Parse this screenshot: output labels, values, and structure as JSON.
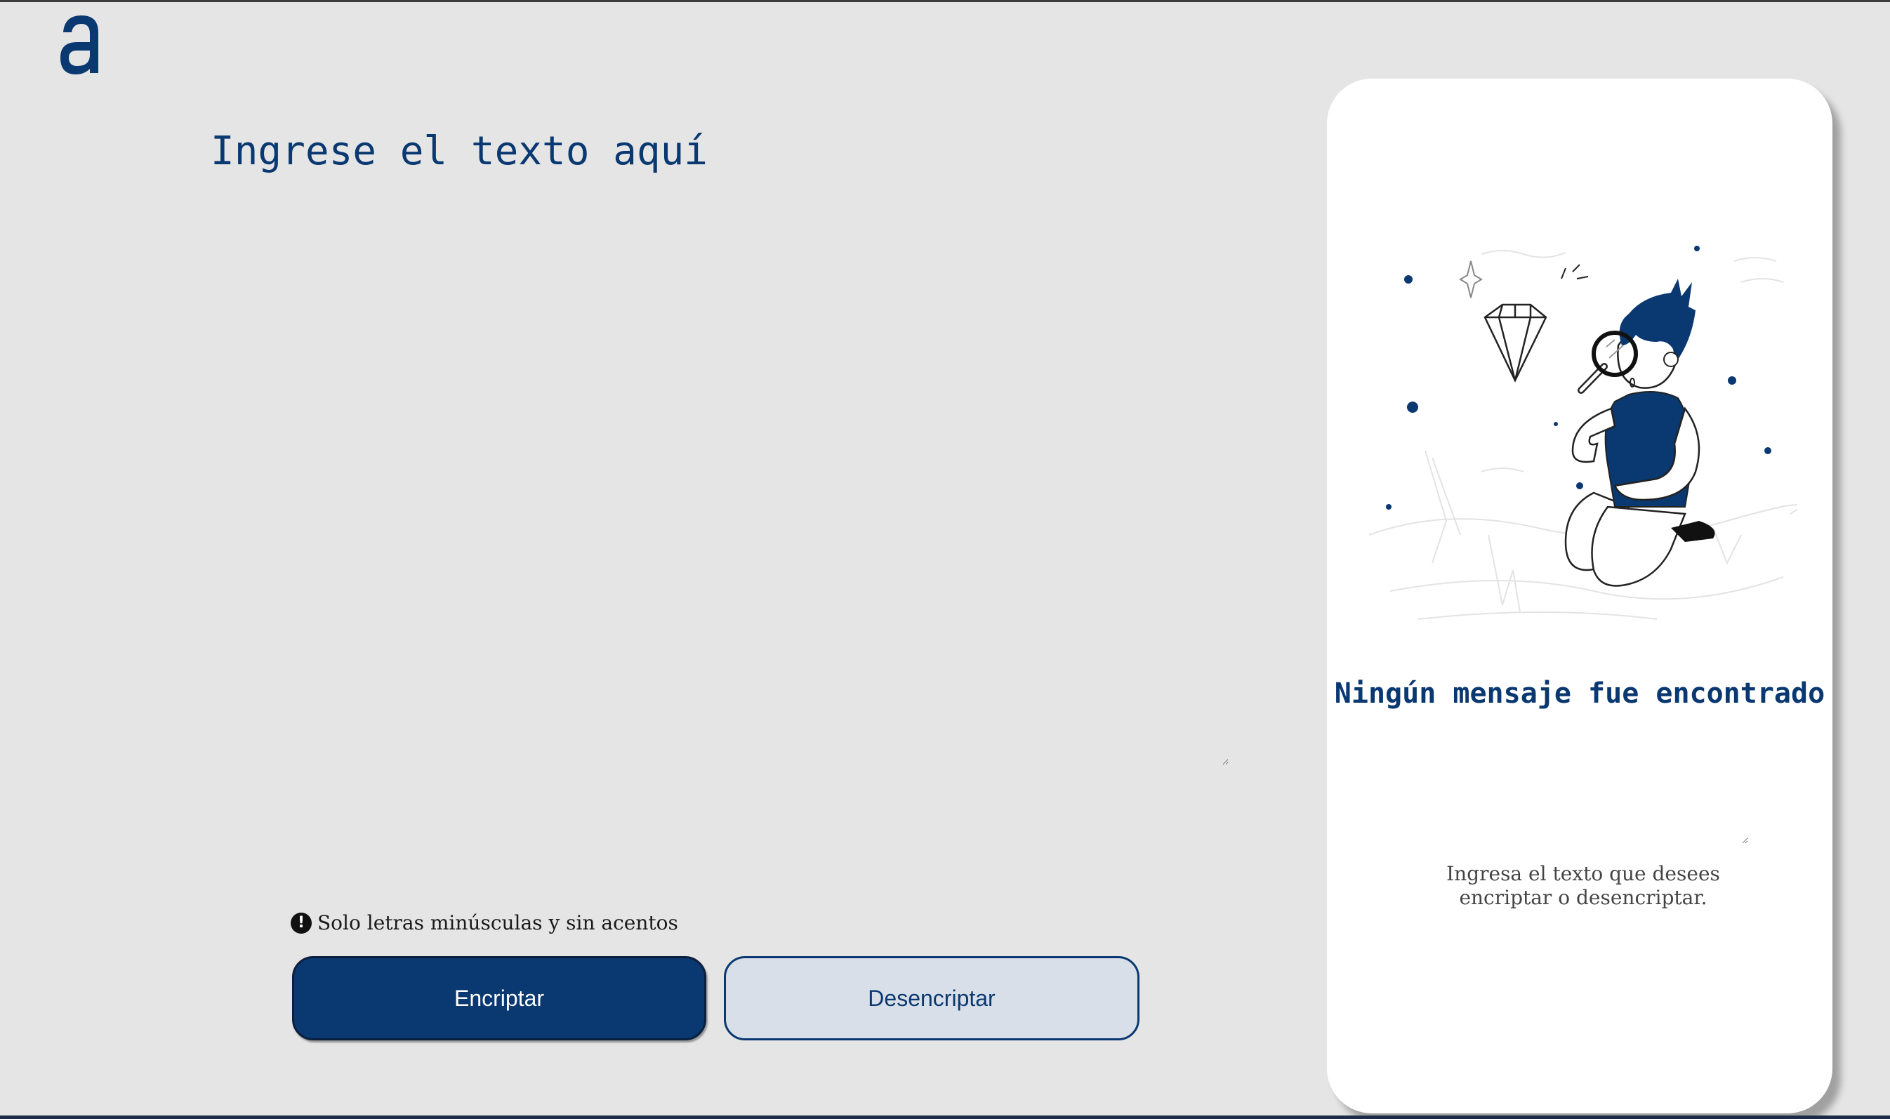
{
  "logo": {
    "icon": "alura-a-logo-icon",
    "color": "#0a3871"
  },
  "input": {
    "placeholder": "Ingrese el texto aquí",
    "value": ""
  },
  "hint": {
    "icon": "exclamation-circle-icon",
    "text": "Solo letras minúsculas y sin acentos"
  },
  "buttons": {
    "encrypt_label": "Encriptar",
    "decrypt_label": "Desencriptar"
  },
  "output_panel": {
    "illustration": "person-with-magnifying-glass-illustration",
    "title": "Ningún mensaje fue encontrado",
    "output_value": "",
    "description": "Ingresa el texto que desees encriptar o desencriptar."
  },
  "colors": {
    "accent": "#0a3871",
    "background": "#e5e5e5",
    "panel": "#ffffff",
    "decrypt_button_bg": "#d8dfe8"
  }
}
